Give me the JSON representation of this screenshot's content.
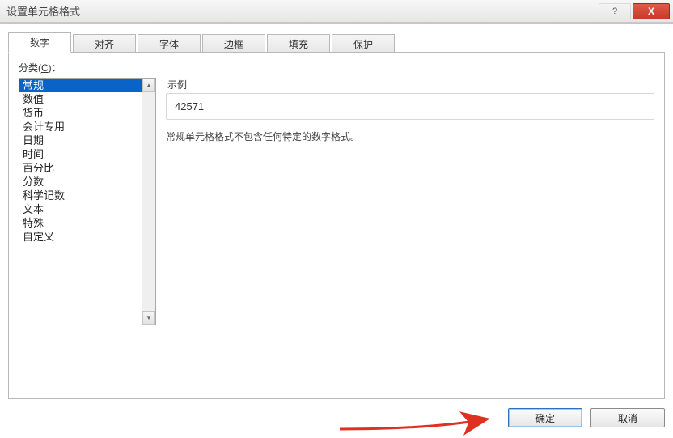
{
  "window": {
    "title": "设置单元格格式"
  },
  "titlebar": {
    "help": "?",
    "close": "X"
  },
  "tabs": [
    {
      "label": "数字"
    },
    {
      "label": "对齐"
    },
    {
      "label": "字体"
    },
    {
      "label": "边框"
    },
    {
      "label": "填充"
    },
    {
      "label": "保护"
    }
  ],
  "panel": {
    "category_label_prefix": "分类(",
    "category_label_key": "C",
    "category_label_suffix": ")：",
    "categories": [
      "常规",
      "数值",
      "货币",
      "会计专用",
      "日期",
      "时间",
      "百分比",
      "分数",
      "科学记数",
      "文本",
      "特殊",
      "自定义"
    ],
    "selected_index": 0,
    "sample_label": "示例",
    "sample_value": "42571",
    "description": "常规单元格格式不包含任何特定的数字格式。"
  },
  "buttons": {
    "ok": "确定",
    "cancel": "取消"
  },
  "scroll": {
    "up": "▲",
    "down": "▼"
  }
}
